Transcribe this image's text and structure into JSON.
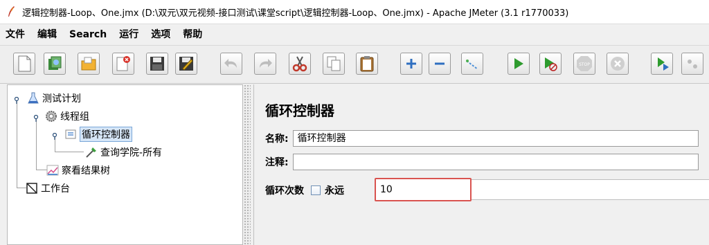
{
  "window": {
    "title": "逻辑控制器-Loop、One.jmx (D:\\双元\\双元视频-接口测试\\课堂script\\逻辑控制器-Loop、One.jmx) - Apache JMeter (3.1 r1770033)"
  },
  "menu": [
    "文件",
    "编辑",
    "Search",
    "运行",
    "选项",
    "帮助"
  ],
  "toolbar": {
    "buttons": [
      "new-icon",
      "templates-icon",
      "open-icon",
      "close-icon",
      "save-icon",
      "save-as-icon",
      "undo-icon",
      "redo-icon",
      "cut-icon",
      "copy-icon",
      "paste-icon",
      "expand-icon",
      "collapse-icon",
      "toggle-icon",
      "start-icon",
      "start-no-pause-icon",
      "stop-icon",
      "shutdown-icon",
      "remote-start-icon",
      "remote-stop-icon"
    ]
  },
  "tree": {
    "nodes": [
      {
        "label": "测试计划",
        "icon": "test-plan-icon"
      },
      {
        "label": "线程组",
        "icon": "thread-group-icon"
      },
      {
        "label": "循环控制器",
        "icon": "loop-controller-icon"
      },
      {
        "label": "查询学院-所有",
        "icon": "http-sampler-icon"
      },
      {
        "label": "察看结果树",
        "icon": "results-tree-icon"
      },
      {
        "label": "工作台",
        "icon": "workbench-icon"
      }
    ]
  },
  "panel": {
    "title": "循环控制器",
    "name_label": "名称:",
    "name_value": "循环控制器",
    "comment_label": "注释:",
    "comment_value": "",
    "loop_label": "循环次数",
    "forever_label": "永远",
    "forever_checked": false,
    "loop_count": "10"
  },
  "colors": {
    "highlight_border": "#d9534f",
    "tree_selection": "#d6e6f7"
  }
}
